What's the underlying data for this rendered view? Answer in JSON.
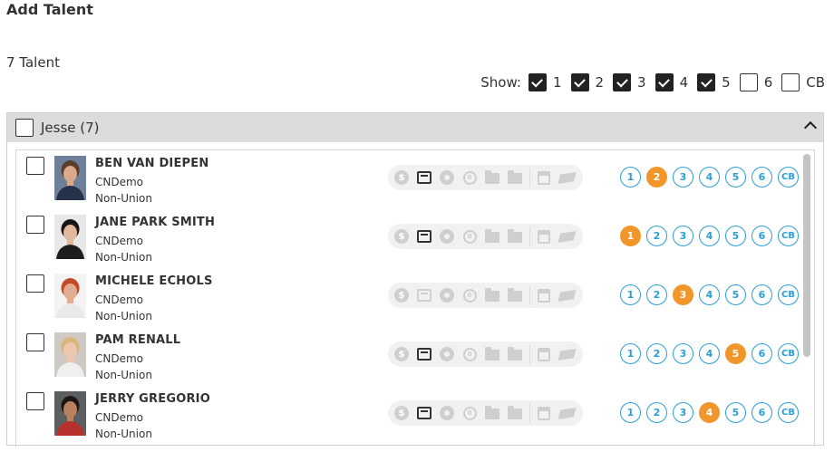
{
  "page": {
    "title": "Add Talent",
    "count_label": "7 Talent"
  },
  "show_filter": {
    "label": "Show:",
    "options": [
      {
        "label": "1",
        "checked": true
      },
      {
        "label": "2",
        "checked": true
      },
      {
        "label": "3",
        "checked": true
      },
      {
        "label": "4",
        "checked": true
      },
      {
        "label": "5",
        "checked": true
      },
      {
        "label": "6",
        "checked": false
      },
      {
        "label": "CB",
        "checked": false
      }
    ]
  },
  "group": {
    "label": "Jesse (7)",
    "checked": false,
    "expanded": true
  },
  "round_labels": [
    "1",
    "2",
    "3",
    "4",
    "5",
    "6",
    "CB"
  ],
  "colors": {
    "round_outline": "#2a9fd6",
    "round_selected": "#f0962a"
  },
  "talent": [
    {
      "name": "BEN VAN DIEPEN",
      "agency": "CNDemo",
      "union": "Non-Union",
      "selected_round": "2",
      "resume_active": true,
      "avatar": "man-blue"
    },
    {
      "name": "JANE PARK SMITH",
      "agency": "CNDemo",
      "union": "Non-Union",
      "selected_round": "1",
      "resume_active": true,
      "avatar": "woman-dark"
    },
    {
      "name": "MICHELE ECHOLS",
      "agency": "CNDemo",
      "union": "Non-Union",
      "selected_round": "3",
      "resume_active": false,
      "avatar": "woman-red"
    },
    {
      "name": "PAM RENALL",
      "agency": "CNDemo",
      "union": "Non-Union",
      "selected_round": "5",
      "resume_active": true,
      "avatar": "woman-blonde"
    },
    {
      "name": "JERRY GREGORIO",
      "agency": "CNDemo",
      "union": "Non-Union",
      "selected_round": "4",
      "resume_active": true,
      "avatar": "man-dark"
    }
  ]
}
